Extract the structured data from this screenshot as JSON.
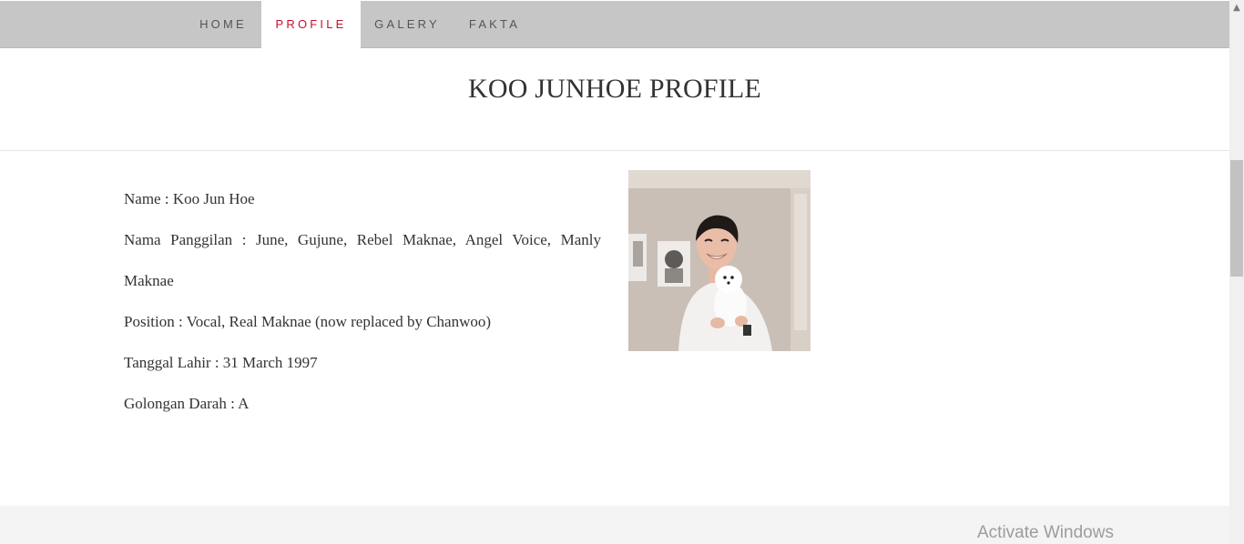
{
  "nav": {
    "items": [
      {
        "label": "HOME"
      },
      {
        "label": "PROFILE",
        "active": true
      },
      {
        "label": "GALERY"
      },
      {
        "label": "FAKTA"
      }
    ],
    "active_color": "#c8102e"
  },
  "header": {
    "title": "KOO JUNHOE PROFILE"
  },
  "profile": {
    "name": "Name : Koo Jun Hoe",
    "nickname": "Nama Panggilan : June, Gujune, Rebel Maknae, Angel Voice, Manly Maknae",
    "position": "Position : Vocal, Real Maknae (now replaced by Chanwoo)",
    "birthdate": "Tanggal Lahir : 31 March 1997",
    "blood_type": "Golongan Darah : A"
  },
  "photo": {
    "description_icon": "profile-photo"
  },
  "watermark": {
    "text": "Activate Windows"
  }
}
